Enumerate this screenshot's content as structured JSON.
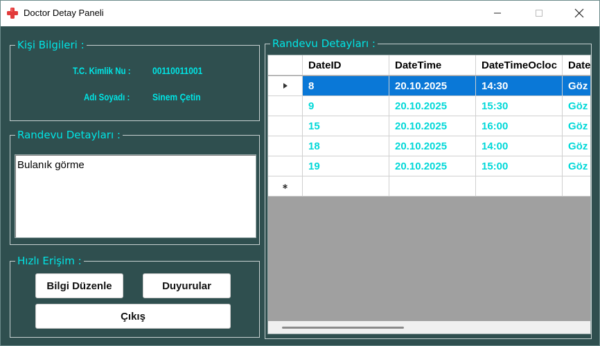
{
  "window": {
    "title": "Doctor Detay Paneli",
    "icon": "red-cross-icon"
  },
  "person_group": {
    "title": "Kişi Bilgileri :",
    "tc_label": "T.C. Kimlik Nu :",
    "tc_value": "00110011001",
    "name_label": "Adı Soyadı :",
    "name_value": "Sinem Çetin"
  },
  "appointment_detail_group": {
    "title": "Randevu Detayları :",
    "text": "Bulanık görme"
  },
  "quick_access_group": {
    "title": "Hızlı Erişim :",
    "edit_button": "Bilgi Düzenle",
    "announcements_button": "Duyurular",
    "exit_button": "Çıkış"
  },
  "appointments_group": {
    "title": "Randevu Detayları :",
    "columns": [
      "DateID",
      "DateTime",
      "DateTimeOcloc",
      "Date"
    ],
    "rows": [
      [
        "8",
        "20.10.2025",
        "14:30",
        "Göz"
      ],
      [
        "9",
        "20.10.2025",
        "15:30",
        "Göz"
      ],
      [
        "15",
        "20.10.2025",
        "16:00",
        "Göz"
      ],
      [
        "18",
        "20.10.2025",
        "14:00",
        "Göz"
      ],
      [
        "19",
        "20.10.2025",
        "15:00",
        "Göz"
      ]
    ],
    "selected_row": 0
  },
  "colors": {
    "background": "#2f4f4f",
    "accent_text": "#00e5e5",
    "selection": "#0a78d7"
  }
}
